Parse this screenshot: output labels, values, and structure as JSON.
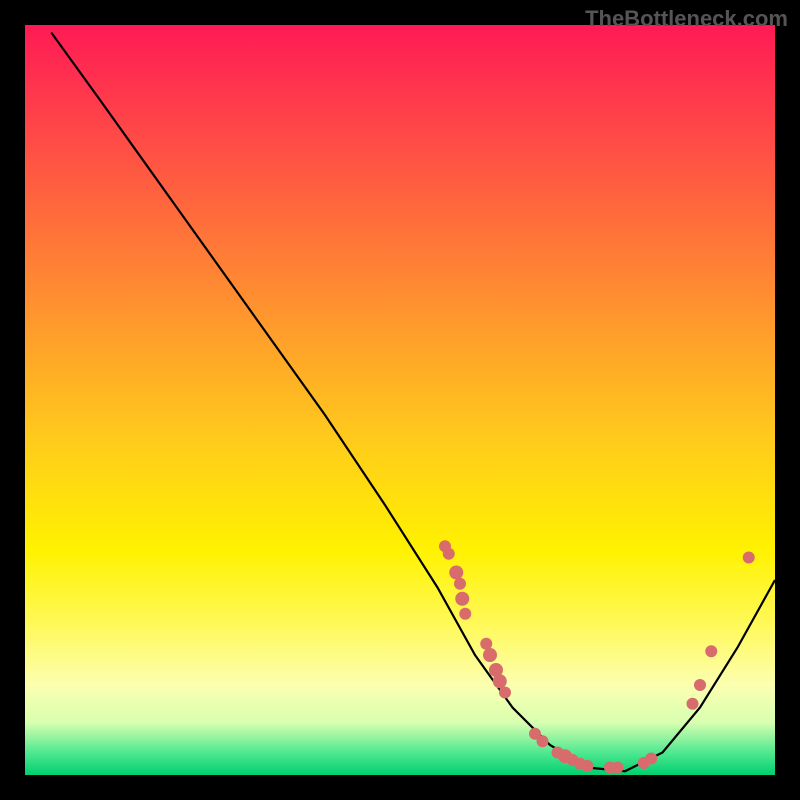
{
  "watermark": "TheBottleneck.com",
  "chart_data": {
    "type": "line",
    "title": "",
    "xlabel": "",
    "ylabel": "",
    "xlim": [
      0,
      100
    ],
    "ylim": [
      0,
      100
    ],
    "curve": [
      {
        "x": 3.5,
        "y": 99.0
      },
      {
        "x": 10.0,
        "y": 90.0
      },
      {
        "x": 20.0,
        "y": 76.0
      },
      {
        "x": 30.0,
        "y": 62.0
      },
      {
        "x": 40.0,
        "y": 48.0
      },
      {
        "x": 48.0,
        "y": 36.0
      },
      {
        "x": 55.0,
        "y": 25.0
      },
      {
        "x": 60.0,
        "y": 16.0
      },
      {
        "x": 65.0,
        "y": 9.0
      },
      {
        "x": 70.0,
        "y": 4.0
      },
      {
        "x": 75.0,
        "y": 1.0
      },
      {
        "x": 80.0,
        "y": 0.5
      },
      {
        "x": 85.0,
        "y": 3.0
      },
      {
        "x": 90.0,
        "y": 9.0
      },
      {
        "x": 95.0,
        "y": 17.0
      },
      {
        "x": 100.0,
        "y": 26.0
      }
    ],
    "points": [
      {
        "x": 56.0,
        "y": 30.5,
        "r": 6
      },
      {
        "x": 56.5,
        "y": 29.5,
        "r": 6
      },
      {
        "x": 57.5,
        "y": 27.0,
        "r": 7
      },
      {
        "x": 58.0,
        "y": 25.5,
        "r": 6
      },
      {
        "x": 58.3,
        "y": 23.5,
        "r": 7
      },
      {
        "x": 58.7,
        "y": 21.5,
        "r": 6
      },
      {
        "x": 61.5,
        "y": 17.5,
        "r": 6
      },
      {
        "x": 62.0,
        "y": 16.0,
        "r": 7
      },
      {
        "x": 62.8,
        "y": 14.0,
        "r": 7
      },
      {
        "x": 63.3,
        "y": 12.5,
        "r": 7
      },
      {
        "x": 64.0,
        "y": 11.0,
        "r": 6
      },
      {
        "x": 68.0,
        "y": 5.5,
        "r": 6
      },
      {
        "x": 69.0,
        "y": 4.5,
        "r": 6
      },
      {
        "x": 71.0,
        "y": 3.0,
        "r": 6
      },
      {
        "x": 72.0,
        "y": 2.5,
        "r": 7
      },
      {
        "x": 73.0,
        "y": 2.0,
        "r": 6
      },
      {
        "x": 74.0,
        "y": 1.5,
        "r": 6
      },
      {
        "x": 75.0,
        "y": 1.2,
        "r": 6
      },
      {
        "x": 78.0,
        "y": 1.0,
        "r": 6
      },
      {
        "x": 79.0,
        "y": 1.0,
        "r": 6
      },
      {
        "x": 82.5,
        "y": 1.6,
        "r": 6
      },
      {
        "x": 83.5,
        "y": 2.2,
        "r": 6
      },
      {
        "x": 89.0,
        "y": 9.5,
        "r": 6
      },
      {
        "x": 90.0,
        "y": 12.0,
        "r": 6
      },
      {
        "x": 91.5,
        "y": 16.5,
        "r": 6
      },
      {
        "x": 96.5,
        "y": 29.0,
        "r": 6
      }
    ]
  }
}
